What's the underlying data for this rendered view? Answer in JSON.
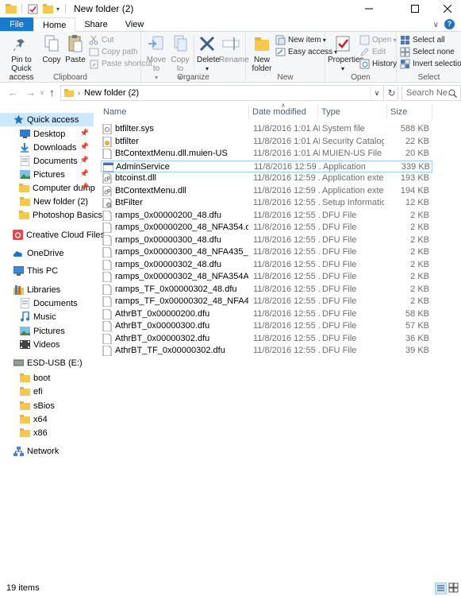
{
  "window": {
    "title": "New folder (2)",
    "controls": [
      "minimize",
      "maximize",
      "close"
    ]
  },
  "ribbon_tabs": [
    {
      "label": "File"
    },
    {
      "label": "Home"
    },
    {
      "label": "Share"
    },
    {
      "label": "View"
    }
  ],
  "ribbon": {
    "clipboard": {
      "label": "Clipboard",
      "pin": "Pin to Quick access",
      "copy": "Copy",
      "paste": "Paste",
      "cut": "Cut",
      "copy_path": "Copy path",
      "paste_shortcut": "Paste shortcut"
    },
    "organize": {
      "label": "Organize",
      "move_to": "Move to",
      "copy_to": "Copy to",
      "delete": "Delete",
      "rename": "Rename"
    },
    "new": {
      "label": "New",
      "new_folder": "New folder",
      "new_item": "New item",
      "easy_access": "Easy access"
    },
    "open": {
      "label": "Open",
      "properties": "Properties",
      "open": "Open",
      "edit": "Edit",
      "history": "History"
    },
    "select": {
      "label": "Select",
      "select_all": "Select all",
      "select_none": "Select none",
      "invert": "Invert selection"
    }
  },
  "address": {
    "path": "New folder (2)",
    "search_placeholder": "Search Ne..."
  },
  "nav": {
    "quick_access": "Quick access",
    "quick_items": [
      {
        "label": "Desktop",
        "pinned": true
      },
      {
        "label": "Downloads",
        "pinned": true
      },
      {
        "label": "Documents",
        "pinned": true
      },
      {
        "label": "Pictures",
        "pinned": true
      },
      {
        "label": "Computer dump",
        "pinned": true
      },
      {
        "label": "New folder (2)",
        "pinned": false
      },
      {
        "label": "Photoshop Basics",
        "pinned": false
      }
    ],
    "creative_cloud": "Creative Cloud Files",
    "onedrive": "OneDrive",
    "this_pc": "This PC",
    "libraries": "Libraries",
    "library_items": [
      "Documents",
      "Music",
      "Pictures",
      "Videos"
    ],
    "usb": "ESD-USB (E:)",
    "usb_items": [
      "boot",
      "efi",
      "sBios",
      "x64",
      "x86"
    ],
    "network": "Network"
  },
  "columns": {
    "name": "Name",
    "date": "Date modified",
    "type": "Type",
    "size": "Size"
  },
  "files": [
    {
      "name": "btfilter.sys",
      "date": "11/8/2016 1:01 AM",
      "type": "System file",
      "size": "588 KB",
      "icon": "system-file-icon"
    },
    {
      "name": "btfilter",
      "date": "11/8/2016 1:01 AM",
      "type": "Security Catalog",
      "size": "22 KB",
      "icon": "catalog-icon"
    },
    {
      "name": "BtContextMenu.dll.muien-US",
      "date": "11/8/2016 1:01 AM",
      "type": "MUIEN-US File",
      "size": "20 KB",
      "icon": "file-icon"
    },
    {
      "name": "AdminService",
      "date": "11/8/2016 12:59 ...",
      "type": "Application",
      "size": "339 KB",
      "icon": "app-icon",
      "selected": true
    },
    {
      "name": "btcoinst.dll",
      "date": "11/8/2016 12:59 ...",
      "type": "Application extens...",
      "size": "193 KB",
      "icon": "dll-icon"
    },
    {
      "name": "BtContextMenu.dll",
      "date": "11/8/2016 12:59 ...",
      "type": "Application extens...",
      "size": "194 KB",
      "icon": "dll-icon"
    },
    {
      "name": "BtFilter",
      "date": "11/8/2016 12:55 ...",
      "type": "Setup Information",
      "size": "12 KB",
      "icon": "setup-info-icon"
    },
    {
      "name": "ramps_0x00000200_48.dfu",
      "date": "11/8/2016 12:55 ...",
      "type": "DFU File",
      "size": "2 KB",
      "icon": "file-icon"
    },
    {
      "name": "ramps_0x00000200_48_NFA354.dfu",
      "date": "11/8/2016 12:55 ...",
      "type": "DFU File",
      "size": "2 KB",
      "icon": "file-icon"
    },
    {
      "name": "ramps_0x00000300_48.dfu",
      "date": "11/8/2016 12:55 ...",
      "type": "DFU File",
      "size": "2 KB",
      "icon": "file-icon"
    },
    {
      "name": "ramps_0x00000300_48_NFA435_10db.dfu",
      "date": "11/8/2016 12:55 ...",
      "type": "DFU File",
      "size": "2 KB",
      "icon": "file-icon"
    },
    {
      "name": "ramps_0x00000302_48.dfu",
      "date": "11/8/2016 12:55 ...",
      "type": "DFU File",
      "size": "2 KB",
      "icon": "file-icon"
    },
    {
      "name": "ramps_0x00000302_48_NFA354A_10db...",
      "date": "11/8/2016 12:55 ...",
      "type": "DFU File",
      "size": "2 KB",
      "icon": "file-icon"
    },
    {
      "name": "ramps_TF_0x00000302_48.dfu",
      "date": "11/8/2016 12:55 ...",
      "type": "DFU File",
      "size": "2 KB",
      "icon": "file-icon"
    },
    {
      "name": "ramps_TF_0x00000302_48_NFA435_10db...",
      "date": "11/8/2016 12:55 ...",
      "type": "DFU File",
      "size": "2 KB",
      "icon": "file-icon"
    },
    {
      "name": "AthrBT_0x00000200.dfu",
      "date": "11/8/2016 12:55 ...",
      "type": "DFU File",
      "size": "58 KB",
      "icon": "file-icon"
    },
    {
      "name": "AthrBT_0x00000300.dfu",
      "date": "11/8/2016 12:55 ...",
      "type": "DFU File",
      "size": "57 KB",
      "icon": "file-icon"
    },
    {
      "name": "AthrBT_0x00000302.dfu",
      "date": "11/8/2016 12:55 ...",
      "type": "DFU File",
      "size": "36 KB",
      "icon": "file-icon"
    },
    {
      "name": "AthrBT_TF_0x00000302.dfu",
      "date": "11/8/2016 12:55 ...",
      "type": "DFU File",
      "size": "39 KB",
      "icon": "file-icon"
    }
  ],
  "status": {
    "count": "19 items"
  },
  "colors": {
    "file_tab": "#1979ca",
    "selection": "#cce8ff",
    "selected_border": "#99d1ff",
    "folder": "#f8c84a",
    "header_text": "#4c607a"
  }
}
